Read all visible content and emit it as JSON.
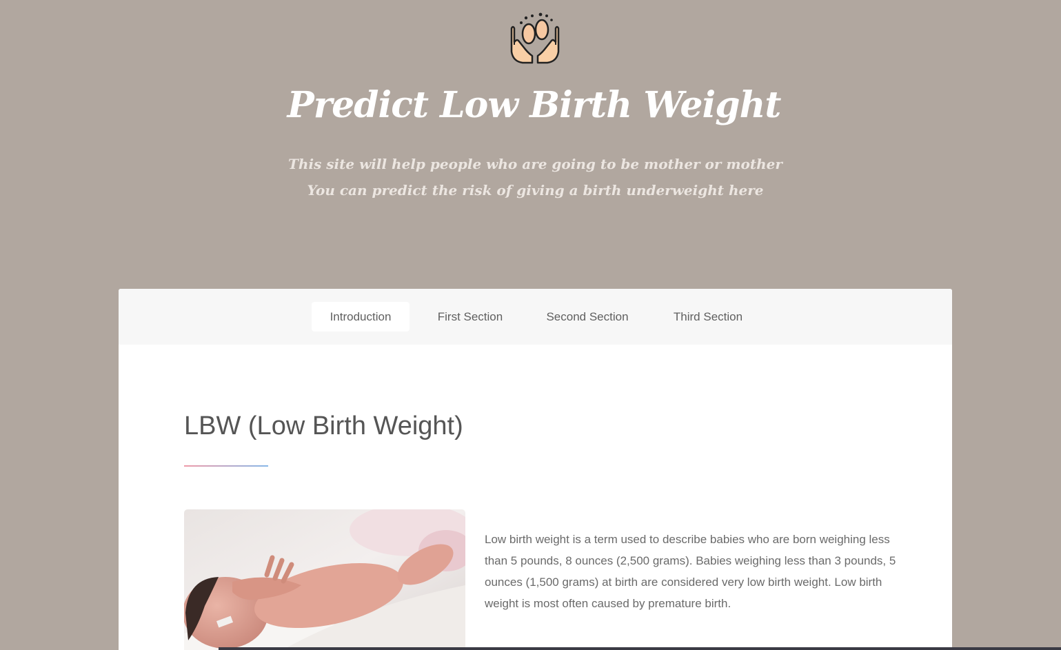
{
  "header": {
    "logo_icon": "hands-holding-baby-feet-icon",
    "title": "Predict Low Birth Weight",
    "subtitle_line1": "This site will help people who are going to be mother or mother",
    "subtitle_line2": "You can predict the risk of giving a birth underweight here"
  },
  "nav": {
    "tabs": [
      {
        "label": "Introduction",
        "active": true
      },
      {
        "label": "First Section",
        "active": false
      },
      {
        "label": "Second Section",
        "active": false
      },
      {
        "label": "Third Section",
        "active": false
      }
    ]
  },
  "main": {
    "section_title": "LBW (Low Birth Weight)",
    "image_subject": "newborn-baby-photo",
    "paragraph": "Low birth weight is a term used to describe babies who are born weighing less than 5 pounds, 8 ounces (2,500 grams). Babies weighing less than 3 pounds, 5 ounces (1,500 grams) at birth are considered very low birth weight. Low birth weight is most often caused by premature birth."
  },
  "colors": {
    "background": "#b1a79f",
    "card": "#ffffff",
    "nav_bar": "#f7f7f7",
    "underline_start": "#ef9aa8",
    "underline_end": "#86b7e8"
  }
}
